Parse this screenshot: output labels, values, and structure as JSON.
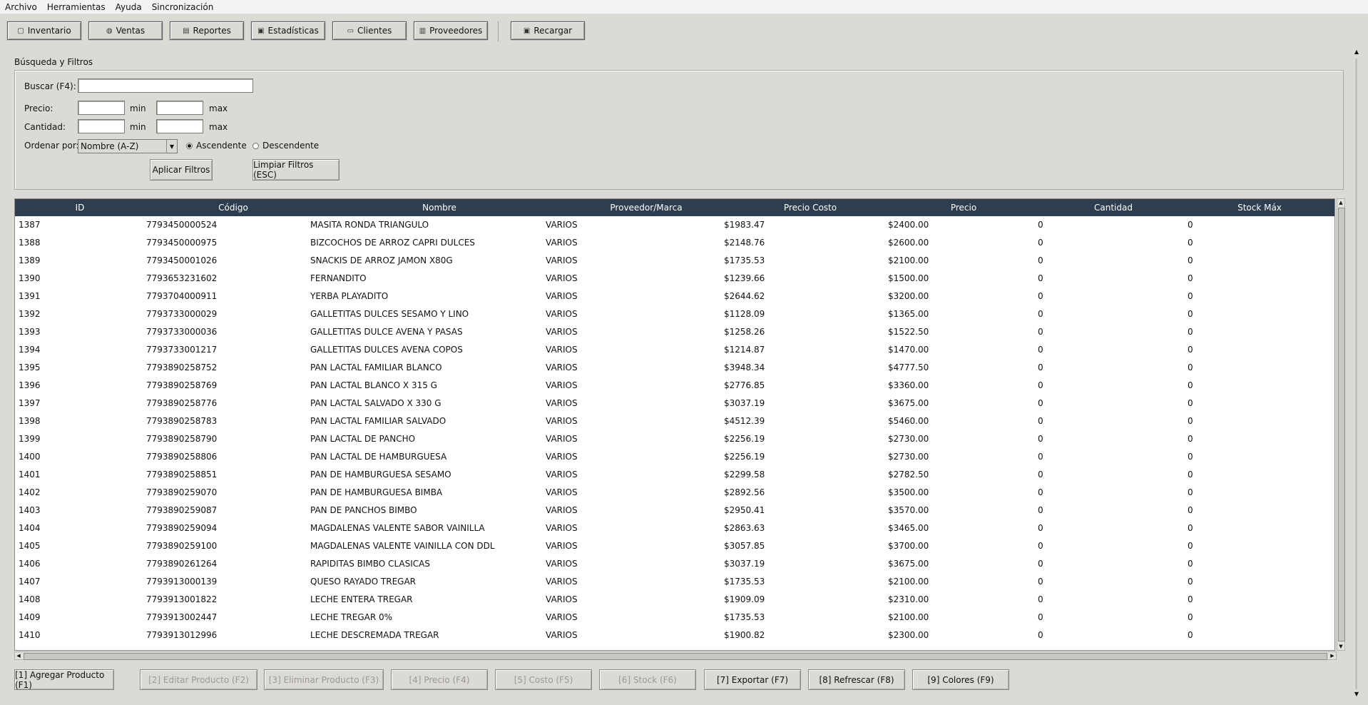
{
  "menu": [
    "Archivo",
    "Herramientas",
    "Ayuda",
    "Sincronización"
  ],
  "toolbar": [
    {
      "label": "Inventario",
      "icon": "box-icon",
      "glyph": "▢"
    },
    {
      "label": "Ventas",
      "icon": "cart-icon",
      "glyph": "◍"
    },
    {
      "label": "Reportes",
      "icon": "report-icon",
      "glyph": "▤"
    },
    {
      "label": "Estadísticas",
      "icon": "chart-icon",
      "glyph": "▣"
    },
    {
      "label": "Clientes",
      "icon": "clients-icon",
      "glyph": "▭"
    },
    {
      "label": "Proveedores",
      "icon": "supplier-icon",
      "glyph": "▥"
    },
    {
      "label": "Recargar",
      "icon": "reload-icon",
      "glyph": "▣"
    }
  ],
  "filters": {
    "group_title": "Búsqueda y Filtros",
    "search_label": "Buscar (F4):",
    "search_value": "",
    "price_label": "Precio:",
    "qty_label": "Cantidad:",
    "min_label": "min",
    "max_label": "max",
    "order_label": "Ordenar por:",
    "order_value": "Nombre (A-Z)",
    "asc_label": "Ascendente",
    "desc_label": "Descendente",
    "asc_selected": true,
    "apply_label": "Aplicar Filtros",
    "clear_label": "Limpiar Filtros (ESC)"
  },
  "table": {
    "columns": [
      "ID",
      "Código",
      "Nombre",
      "Proveedor/Marca",
      "Precio Costo",
      "Precio",
      "Cantidad",
      "Stock Máx"
    ],
    "rows": [
      [
        "1387",
        "7793450000524",
        "MASITA RONDA TRIANGULO",
        "VARIOS",
        "$1983.47",
        "$2400.00",
        "0",
        "0"
      ],
      [
        "1388",
        "7793450000975",
        "BIZCOCHOS DE ARROZ CAPRI DULCES",
        "VARIOS",
        "$2148.76",
        "$2600.00",
        "0",
        "0"
      ],
      [
        "1389",
        "7793450001026",
        "SNACKIS DE ARROZ JAMON X80G",
        "VARIOS",
        "$1735.53",
        "$2100.00",
        "0",
        "0"
      ],
      [
        "1390",
        "7793653231602",
        "FERNANDITO",
        "VARIOS",
        "$1239.66",
        "$1500.00",
        "0",
        "0"
      ],
      [
        "1391",
        "7793704000911",
        "YERBA PLAYADITO",
        "VARIOS",
        "$2644.62",
        "$3200.00",
        "0",
        "0"
      ],
      [
        "1392",
        "7793733000029",
        "GALLETITAS DULCES SESAMO Y LINO",
        "VARIOS",
        "$1128.09",
        "$1365.00",
        "0",
        "0"
      ],
      [
        "1393",
        "7793733000036",
        "GALLETITAS DULCE AVENA Y PASAS",
        "VARIOS",
        "$1258.26",
        "$1522.50",
        "0",
        "0"
      ],
      [
        "1394",
        "7793733001217",
        "GALLETITAS DULCES AVENA COPOS",
        "VARIOS",
        "$1214.87",
        "$1470.00",
        "0",
        "0"
      ],
      [
        "1395",
        "7793890258752",
        "PAN LACTAL FAMILIAR BLANCO",
        "VARIOS",
        "$3948.34",
        "$4777.50",
        "0",
        "0"
      ],
      [
        "1396",
        "7793890258769",
        "PAN LACTAL BLANCO X 315 G",
        "VARIOS",
        "$2776.85",
        "$3360.00",
        "0",
        "0"
      ],
      [
        "1397",
        "7793890258776",
        "PAN LACTAL SALVADO X 330 G",
        "VARIOS",
        "$3037.19",
        "$3675.00",
        "0",
        "0"
      ],
      [
        "1398",
        "7793890258783",
        "PAN LACTAL FAMILIAR SALVADO",
        "VARIOS",
        "$4512.39",
        "$5460.00",
        "0",
        "0"
      ],
      [
        "1399",
        "7793890258790",
        "PAN LACTAL DE PANCHO",
        "VARIOS",
        "$2256.19",
        "$2730.00",
        "0",
        "0"
      ],
      [
        "1400",
        "7793890258806",
        "PAN LACTAL DE HAMBURGUESA",
        "VARIOS",
        "$2256.19",
        "$2730.00",
        "0",
        "0"
      ],
      [
        "1401",
        "7793890258851",
        "PAN DE HAMBURGUESA SESAMO",
        "VARIOS",
        "$2299.58",
        "$2782.50",
        "0",
        "0"
      ],
      [
        "1402",
        "7793890259070",
        "PAN DE HAMBURGUESA BIMBA",
        "VARIOS",
        "$2892.56",
        "$3500.00",
        "0",
        "0"
      ],
      [
        "1403",
        "7793890259087",
        "PAN DE PANCHOS BIMBO",
        "VARIOS",
        "$2950.41",
        "$3570.00",
        "0",
        "0"
      ],
      [
        "1404",
        "7793890259094",
        "MAGDALENAS VALENTE SABOR VAINILLA",
        "VARIOS",
        "$2863.63",
        "$3465.00",
        "0",
        "0"
      ],
      [
        "1405",
        "7793890259100",
        "MAGDALENAS VALENTE VAINILLA CON DDL",
        "VARIOS",
        "$3057.85",
        "$3700.00",
        "0",
        "0"
      ],
      [
        "1406",
        "7793890261264",
        "RAPIDITAS BIMBO CLASICAS",
        "VARIOS",
        "$3037.19",
        "$3675.00",
        "0",
        "0"
      ],
      [
        "1407",
        "7793913000139",
        "QUESO RAYADO TREGAR",
        "VARIOS",
        "$1735.53",
        "$2100.00",
        "0",
        "0"
      ],
      [
        "1408",
        "7793913001822",
        "LECHE ENTERA TREGAR",
        "VARIOS",
        "$1909.09",
        "$2310.00",
        "0",
        "0"
      ],
      [
        "1409",
        "7793913002447",
        "LECHE TREGAR 0%",
        "VARIOS",
        "$1735.53",
        "$2100.00",
        "0",
        "0"
      ],
      [
        "1410",
        "7793913012996",
        "LECHE DESCREMADA TREGAR",
        "VARIOS",
        "$1900.82",
        "$2300.00",
        "0",
        "0"
      ]
    ]
  },
  "actions": [
    {
      "label": "[1] Agregar Producto (F1)",
      "enabled": true
    },
    {
      "label": "[2] Editar Producto (F2)",
      "enabled": false
    },
    {
      "label": "[3] Eliminar Producto (F3)",
      "enabled": false
    },
    {
      "label": "[4] Precio (F4)",
      "enabled": false
    },
    {
      "label": "[5] Costo (F5)",
      "enabled": false
    },
    {
      "label": "[6] Stock (F6)",
      "enabled": false
    },
    {
      "label": "[7] Exportar (F7)",
      "enabled": true
    },
    {
      "label": "[8] Refrescar (F8)",
      "enabled": true
    },
    {
      "label": "[9] Colores (F9)",
      "enabled": true
    }
  ],
  "colors": {
    "header_bg": "#2c3e50",
    "window_bg": "#dcdad5"
  }
}
